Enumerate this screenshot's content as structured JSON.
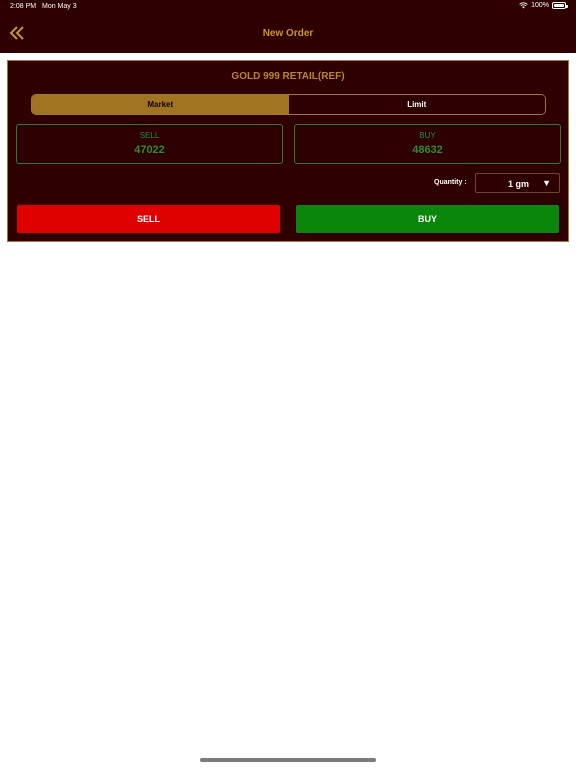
{
  "status_bar": {
    "time": "2:08 PM",
    "date": "Mon May 3",
    "battery": "100%"
  },
  "nav": {
    "title": "New Order",
    "back_icon": "double-chevron-left-icon"
  },
  "order": {
    "instrument": "GOLD 999 RETAIL(REF)",
    "tabs": [
      {
        "label": "Market",
        "active": true
      },
      {
        "label": "Limit",
        "active": false
      }
    ],
    "sell": {
      "label": "SELL",
      "price": "47022"
    },
    "buy": {
      "label": "BUY",
      "price": "48632"
    },
    "quantity": {
      "label": "Quantity :",
      "value": "1 gm"
    },
    "sell_button": "SELL",
    "buy_button": "BUY"
  },
  "colors": {
    "background_dark": "#2e0002",
    "accent_gold": "#c8952a",
    "price_green": "#2e8b2e",
    "sell_red": "#e00000",
    "buy_green": "#0a860a"
  }
}
